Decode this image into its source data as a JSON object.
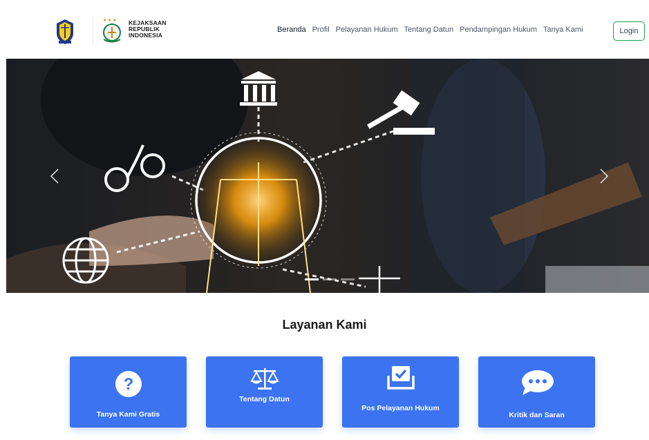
{
  "header": {
    "brand_lines": [
      "KEJAKSAAN",
      "REPUBLIK",
      "INDONESIA"
    ],
    "nav": [
      "Beranda",
      "Profil",
      "Pelayanan Hukum",
      "Tentang Datun",
      "Pendampingan Hukum",
      "Tanya Kami"
    ],
    "active_nav": "Beranda",
    "login_label": "Login"
  },
  "hero": {
    "prev_icon": "chevron-left-icon",
    "next_icon": "chevron-right-icon",
    "slide_count": 3,
    "active_slide": 1
  },
  "section": {
    "title": "Layanan Kami"
  },
  "services": [
    {
      "label": "Tanya Kami Gratis",
      "icon": "question-circle-icon"
    },
    {
      "label": "Tentang Datun",
      "icon": "scale-icon"
    },
    {
      "label": "Pos Pelayanan Hukum",
      "icon": "check-box-icon"
    },
    {
      "label": "Kritik dan Saran",
      "icon": "chat-bubble-icon"
    }
  ],
  "colors": {
    "accent": "#3b73f0",
    "login_border": "#16a34a",
    "glow": "#f59e0b"
  }
}
